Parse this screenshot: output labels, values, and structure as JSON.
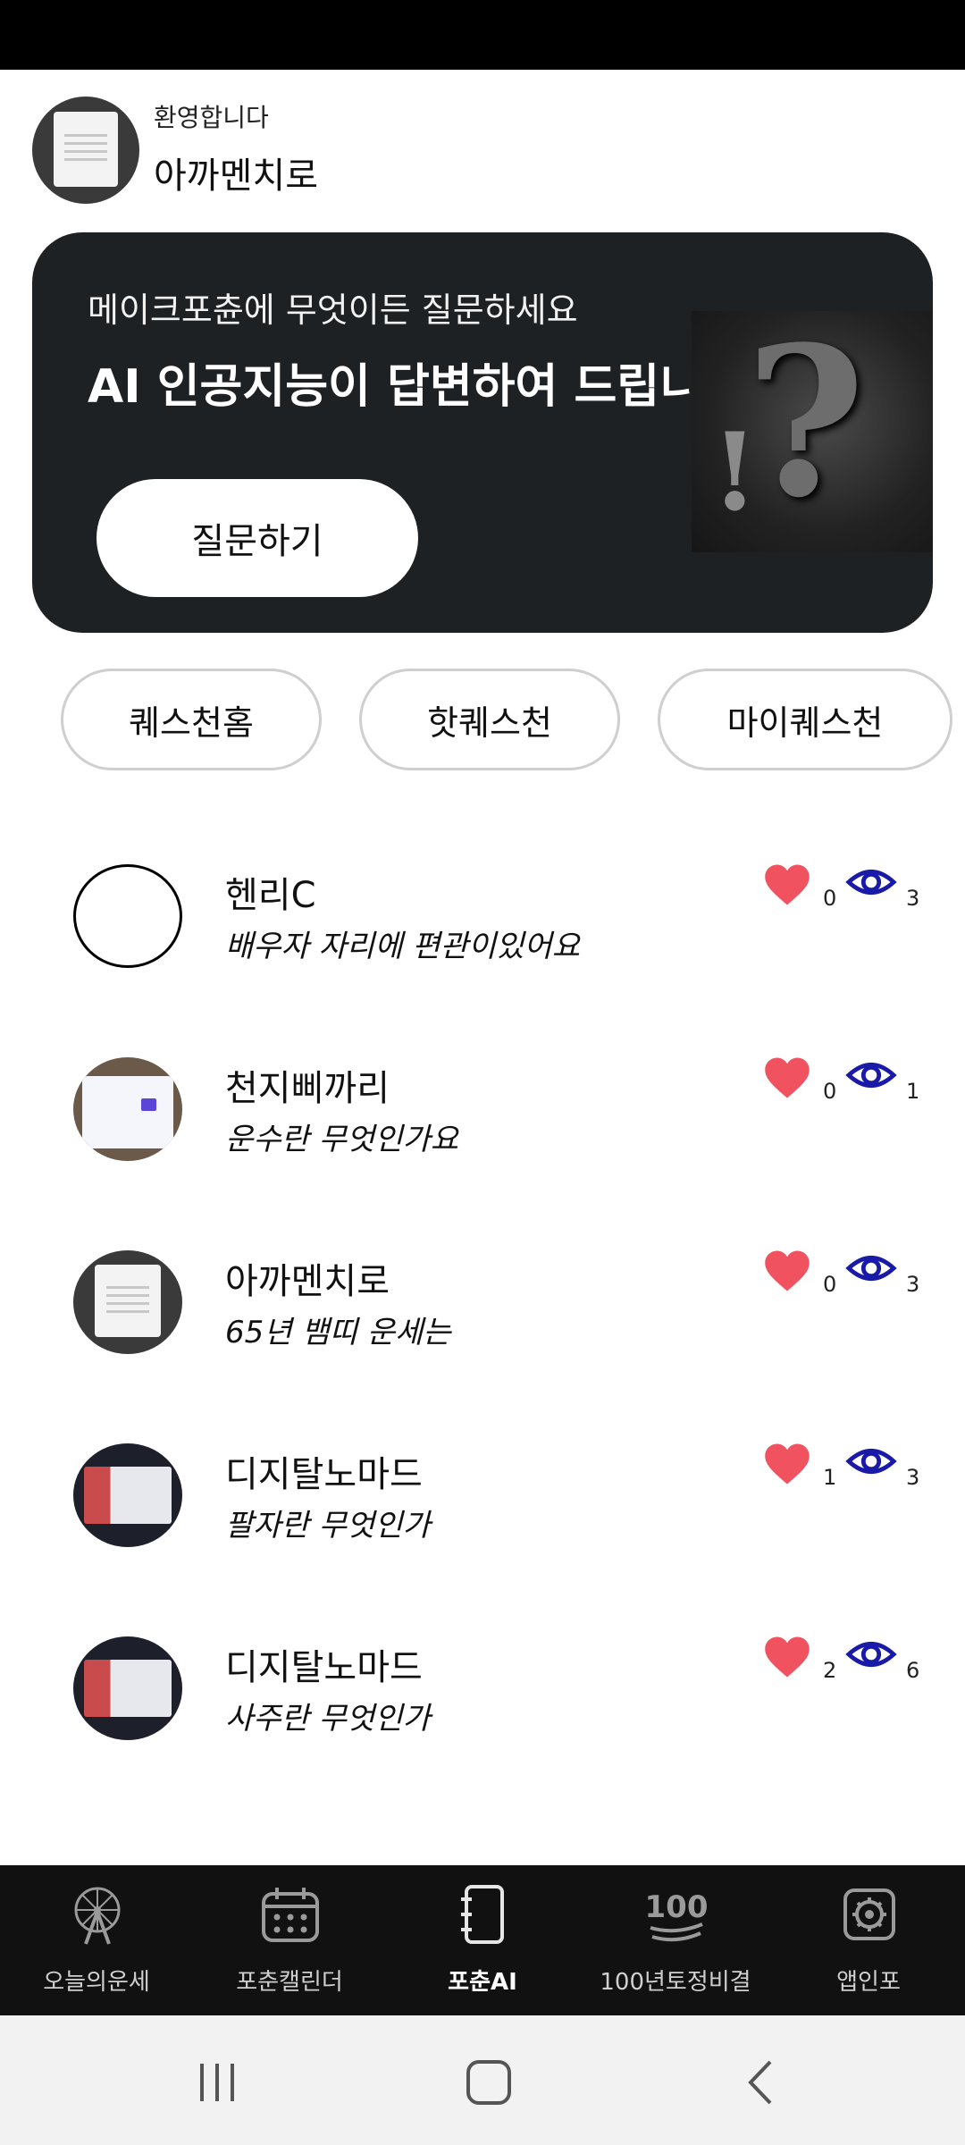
{
  "header": {
    "welcome": "환영합니다",
    "username": "아까멘치로"
  },
  "hero": {
    "subtitle": "메이크포츈에 무엇이든 질문하세요",
    "title": "AI 인공지능이 답변하여 드립니다",
    "ask_button": "질문하기",
    "image_icon": "question-exclamation-image"
  },
  "tabs": [
    {
      "label": "퀘스천홈"
    },
    {
      "label": "핫퀘스천"
    },
    {
      "label": "마이퀘스천"
    }
  ],
  "questions": [
    {
      "name": "헨리C",
      "question": "배우자 자리에 편관이있어요",
      "likes": "0",
      "views": "3",
      "avatar": "empty"
    },
    {
      "name": "천지삐까리",
      "question": "운수란 무엇인가요",
      "likes": "0",
      "views": "1",
      "avatar": "form"
    },
    {
      "name": "아까멘치로",
      "question": "65년 뱀띠 운세는",
      "likes": "0",
      "views": "3",
      "avatar": "photo"
    },
    {
      "name": "디지탈노마드",
      "question": "팔자란 무엇인가",
      "likes": "1",
      "views": "3",
      "avatar": "screen"
    },
    {
      "name": "디지탈노마드",
      "question": "사주란 무엇인가",
      "likes": "2",
      "views": "6",
      "avatar": "screen"
    }
  ],
  "bottom_nav": [
    {
      "label": "오늘의운세",
      "icon": "ferris-wheel-icon"
    },
    {
      "label": "포춘캘린더",
      "icon": "calendar-icon"
    },
    {
      "label": "포춘AI",
      "icon": "notebook-icon",
      "active": true
    },
    {
      "label": "100년토정비결",
      "icon": "hundred-icon"
    },
    {
      "label": "앱인포",
      "icon": "gear-icon"
    }
  ],
  "colors": {
    "hero_bg": "#1e2124",
    "heart": "#f0525f",
    "eye": "#1a1aa8",
    "nav_bg": "#111111"
  }
}
